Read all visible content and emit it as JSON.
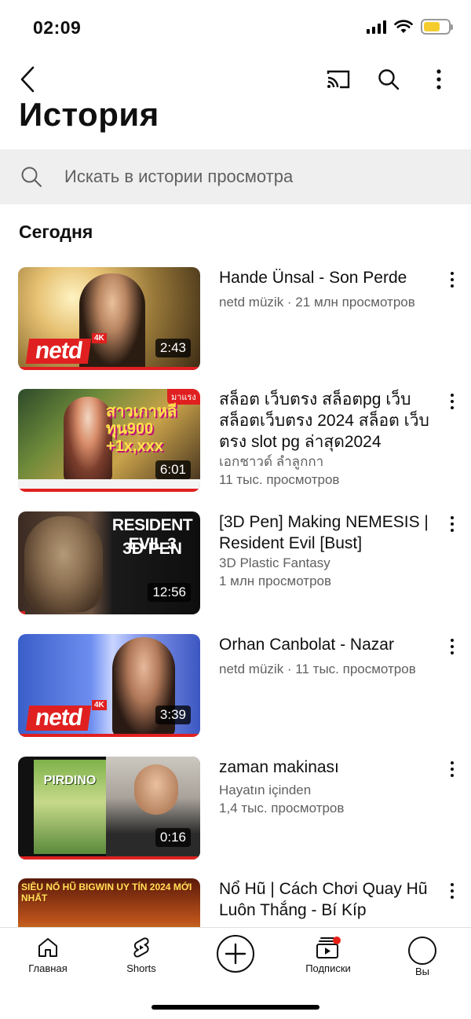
{
  "status_bar": {
    "time": "02:09"
  },
  "header": {
    "title": "История",
    "back_icon": "chevron-left-icon",
    "cast_icon": "cast-icon",
    "search_icon": "search-icon",
    "more_icon": "more-vertical-icon"
  },
  "search": {
    "placeholder": "Искать в истории просмотра"
  },
  "section": {
    "title": "Сегодня"
  },
  "videos": [
    {
      "title": "Hande Ünsal - Son Perde",
      "channel": "netd müzik · 21 млн просмотров",
      "views": "",
      "duration": "2:43",
      "thumb_text": "netd",
      "thumb_badge": "4K"
    },
    {
      "title": "สล็อต เว็บตรง สล็อตpg เว็บ สล็อตเว็บตรง 2024 สล็อต เว็บตรง slot pg ล่าสุด2024",
      "channel": "เอกชาวด์ ลำลูกกา",
      "views": "11 тыс. просмотров",
      "duration": "6:01",
      "thumb_text": "สาวเกาหลี ทุน900 +1x,xxx",
      "thumb_badge": "มาแรง"
    },
    {
      "title": "[3D Pen] Making NEMESIS | Resident Evil [Bust]",
      "channel": "3D Plastic Fantasy",
      "views": "1 млн просмотров",
      "duration": "12:56",
      "thumb_text": "RESIDENT EVIL 3",
      "thumb_badge": "3D PEN"
    },
    {
      "title": "Orhan Canbolat - Nazar",
      "channel": "netd müzik · 11 тыс. просмотров",
      "views": "",
      "duration": "3:39",
      "thumb_text": "netd",
      "thumb_badge": "4K"
    },
    {
      "title": "zaman makinası",
      "channel": "Hayatın içinden",
      "views": "1,4 тыс. просмотров",
      "duration": "0:16",
      "thumb_text": "PIRDINO",
      "thumb_badge": ""
    },
    {
      "title": "Nổ Hũ | Cách Chơi Quay Hũ Luôn Thắng - Bí Kíp",
      "channel": "",
      "views": "",
      "duration": "",
      "thumb_text": "SIÊU NỔ HŨ BIGWIN UY TÍN 2024 MỚI NHẤT",
      "thumb_badge": ""
    }
  ],
  "bottom_nav": [
    {
      "label": "Главная",
      "icon": "home-icon"
    },
    {
      "label": "Shorts",
      "icon": "shorts-icon"
    },
    {
      "label": "",
      "icon": "create-plus-icon"
    },
    {
      "label": "Подписки",
      "icon": "subscriptions-icon"
    },
    {
      "label": "Вы",
      "icon": "profile-icon"
    }
  ]
}
